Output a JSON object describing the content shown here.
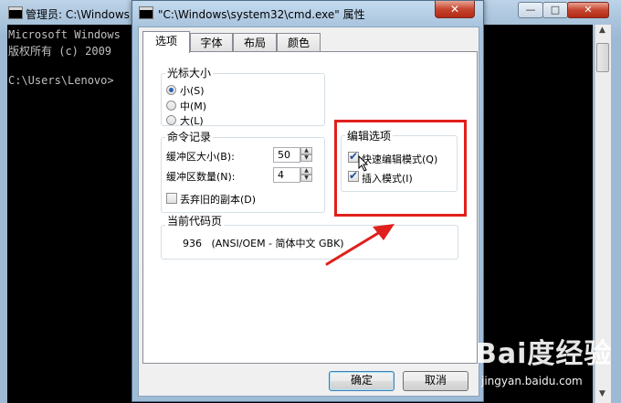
{
  "background_window": {
    "title": "管理员: C:\\Windows",
    "controls": [
      "—",
      "□",
      "✕"
    ],
    "console_lines": [
      "Microsoft Windows",
      "版权所有 (c) 2009",
      "",
      "C:\\Users\\Lenovo>"
    ]
  },
  "dialog": {
    "title": "\"C:\\Windows\\system32\\cmd.exe\" 属性",
    "close": "✕",
    "tabs": [
      {
        "label": "选项",
        "active": true
      },
      {
        "label": "字体",
        "active": false
      },
      {
        "label": "布局",
        "active": false
      },
      {
        "label": "颜色",
        "active": false
      }
    ],
    "cursor_size": {
      "legend": "光标大小",
      "options": [
        {
          "label": "小(S)",
          "checked": true
        },
        {
          "label": "中(M)",
          "checked": false
        },
        {
          "label": "大(L)",
          "checked": false
        }
      ]
    },
    "command_history": {
      "legend": "命令记录",
      "buffer_size_label": "缓冲区大小(B):",
      "buffer_size_value": "50",
      "buffer_count_label": "缓冲区数量(N):",
      "buffer_count_value": "4",
      "discard_old_label": "丢弃旧的副本(D)",
      "discard_old_checked": false
    },
    "edit_options": {
      "legend": "编辑选项",
      "quick_edit_label": "快速编辑模式(Q)",
      "quick_edit_checked": true,
      "insert_mode_label": "插入模式(I)",
      "insert_mode_checked": true
    },
    "code_page": {
      "legend": "当前代码页",
      "value": "936   (ANSI/OEM - 简体中文 GBK)"
    },
    "buttons": {
      "ok": "确定",
      "cancel": "取消"
    }
  },
  "annotation": {
    "highlight_color": "#e0201b"
  },
  "watermark": {
    "logo": "Bai度经验",
    "url": "jingyan.baidu.com"
  }
}
